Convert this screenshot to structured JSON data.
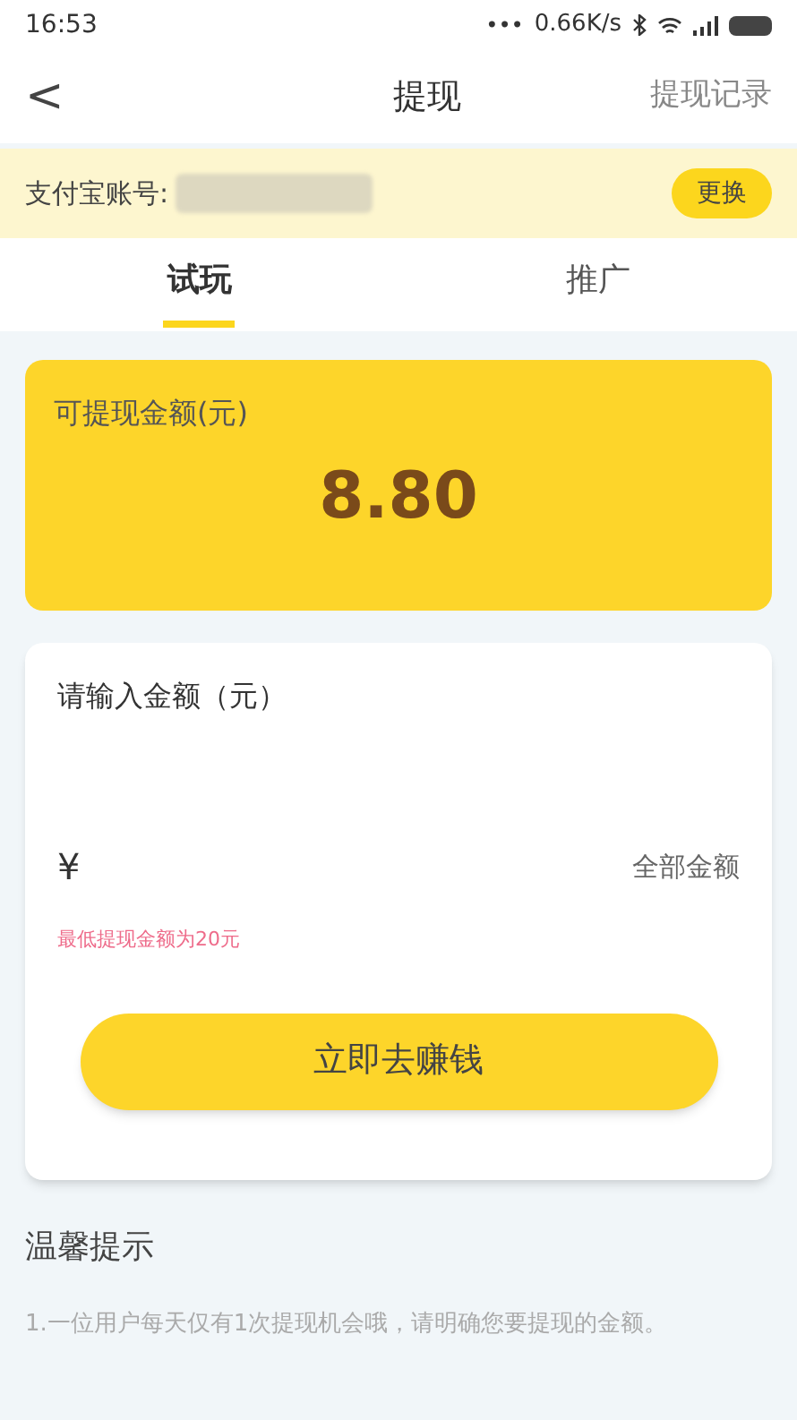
{
  "status_bar": {
    "time": "16:53",
    "dots": "•••",
    "speed": "0.66K/s"
  },
  "nav": {
    "back": "<",
    "title": "提现",
    "action": "提现记录"
  },
  "account": {
    "label": "支付宝账号:",
    "button": "更换"
  },
  "tabs": [
    {
      "label": "试玩",
      "selected": true
    },
    {
      "label": "推广",
      "selected": false
    }
  ],
  "balance": {
    "label": "可提现金额(元)",
    "amount": "8.80"
  },
  "form": {
    "label": "请输入金额（元）",
    "currency": "¥",
    "all_button": "全部金额",
    "hint": "最低提现金额为20元",
    "submit": "立即去赚钱"
  },
  "tips": {
    "title": "温馨提示",
    "items": [
      "1.一位用户每天仅有1次提现机会哦，请明确您要提现的金额。"
    ]
  }
}
